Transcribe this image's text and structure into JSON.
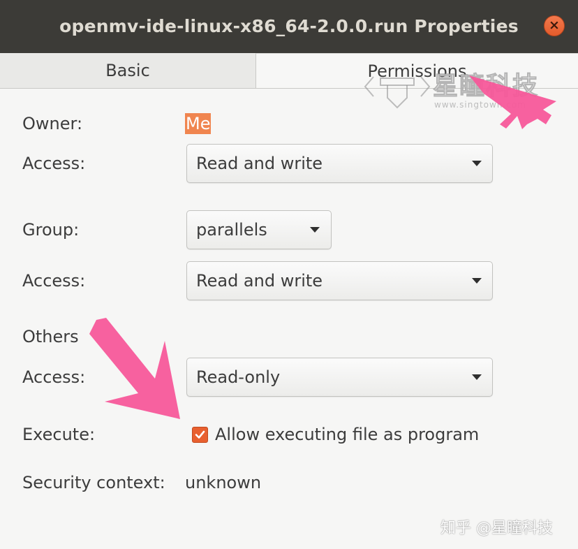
{
  "window": {
    "title": "openmv-ide-linux-x86_64-2.0.0.run Properties",
    "close_icon": "close-icon",
    "close_glyph": "×"
  },
  "tabs": [
    {
      "label": "Basic",
      "selected": false
    },
    {
      "label": "Permissions",
      "selected": true
    }
  ],
  "owner": {
    "label": "Owner:",
    "value": "Me",
    "access_label": "Access:",
    "access_value": "Read and write"
  },
  "group": {
    "label": "Group:",
    "value": "parallels",
    "access_label": "Access:",
    "access_value": "Read and write"
  },
  "others": {
    "label": "Others",
    "access_label": "Access:",
    "access_value": "Read-only"
  },
  "execute": {
    "label": "Execute:",
    "checkbox_label": "Allow executing file as program",
    "checked": true
  },
  "security": {
    "label": "Security context:",
    "value": "unknown"
  },
  "watermark": {
    "brand": "星瞳科技",
    "url": "www.singtown.com",
    "credit": "知乎 @星瞳科技"
  },
  "colors": {
    "titlebar": "#3c3b37",
    "accent": "#e8602f",
    "annotation_arrow": "#f7599a"
  }
}
